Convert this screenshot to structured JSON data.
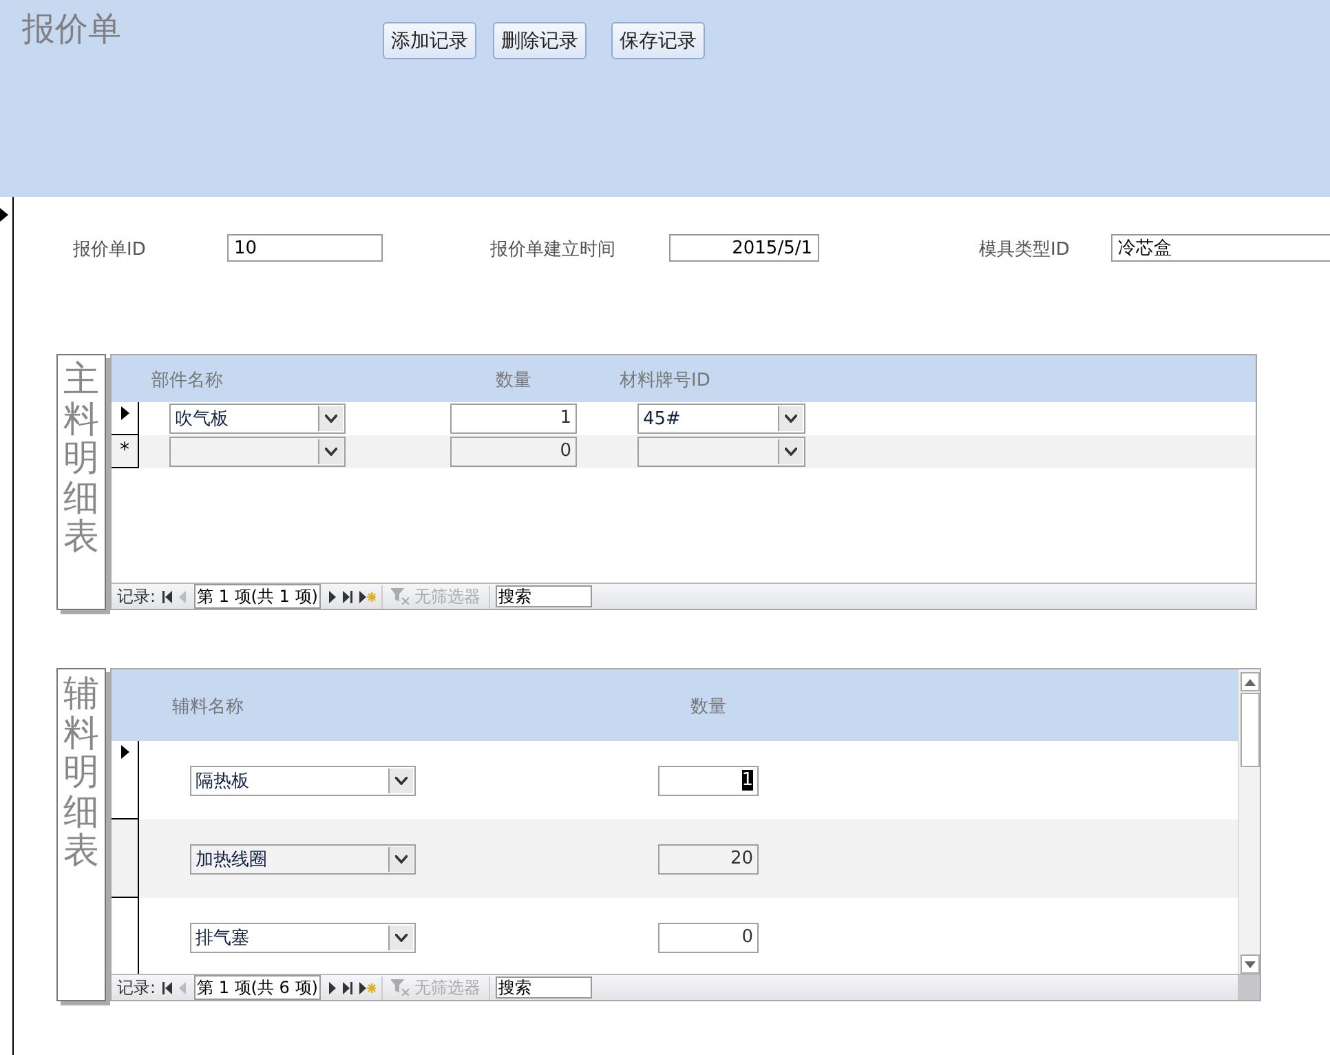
{
  "title": "报价单",
  "buttons": [
    "添加记录",
    "删除记录",
    "保存记录"
  ],
  "record_selected": true,
  "fields": [
    {
      "label": "报价单ID",
      "value": "10",
      "kind": "text"
    },
    {
      "label": "报价单建立时间",
      "value": "2015/5/1",
      "kind": "date"
    },
    {
      "label": "模具类型ID",
      "value": "冷芯盒",
      "kind": "text"
    }
  ],
  "main_materials": {
    "caption": "主料明细表",
    "columns": [
      {
        "label": "部件名称",
        "kind": "combo"
      },
      {
        "label": "数量",
        "kind": "number"
      },
      {
        "label": "材料牌号ID",
        "kind": "combo"
      }
    ],
    "rows": [
      {
        "selected": true,
        "cells": [
          {
            "value": "吹气板",
            "selected": false
          },
          {
            "value": "1",
            "selected": false
          },
          {
            "value": "45#",
            "selected": false
          }
        ]
      },
      {
        "marker": "*",
        "selected": false,
        "cells": [
          {
            "selected": false
          },
          {
            "value": "0",
            "selected": false
          },
          {
            "selected": false
          }
        ]
      }
    ],
    "nav": {
      "label": "记录:",
      "position": "第 1 项(共 1 项)",
      "filter": "无筛选器",
      "search_placeholder": "搜索"
    }
  },
  "aux_materials": {
    "caption": "辅料明细表",
    "columns": [
      {
        "label": "辅料名称",
        "kind": "combo"
      },
      {
        "label": "数量",
        "kind": "number"
      }
    ],
    "rows": [
      {
        "selected": true,
        "cells": [
          {
            "value": "隔热板",
            "selected": false
          },
          {
            "value": "1",
            "selected": true
          }
        ]
      },
      {
        "selected": false,
        "cells": [
          {
            "value": "加热线圈",
            "selected": false
          },
          {
            "value": "20",
            "selected": false
          }
        ]
      },
      {
        "selected": false,
        "cells": [
          {
            "value": "排气塞",
            "selected": false
          },
          {
            "value": "0",
            "selected": false
          }
        ]
      }
    ],
    "nav": {
      "label": "记录:",
      "position": "第 1 项(共 6 项)",
      "filter": "无筛选器",
      "search_placeholder": "搜索"
    }
  }
}
